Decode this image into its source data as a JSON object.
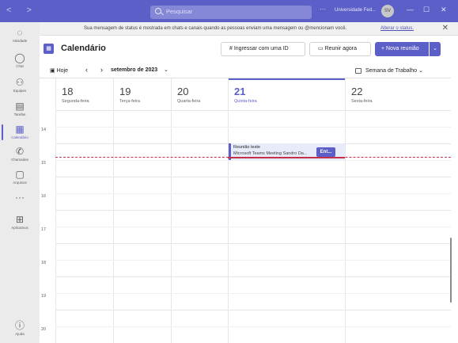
{
  "titlebar": {
    "search_placeholder": "Pesquisar",
    "org": "Universidade Fed...",
    "avatar_initials": "SV"
  },
  "rail": [
    {
      "label": "Atividade",
      "icon": "bell-icon"
    },
    {
      "label": "Chat",
      "icon": "chat-icon"
    },
    {
      "label": "Equipes",
      "icon": "teams-icon"
    },
    {
      "label": "Tarefas",
      "icon": "tasks-icon"
    },
    {
      "label": "Calendário",
      "icon": "calendar-icon"
    },
    {
      "label": "Chamadas",
      "icon": "phone-icon"
    },
    {
      "label": "Arquivos",
      "icon": "files-icon"
    },
    {
      "label": "Aplicativos",
      "icon": "apps-icon"
    },
    {
      "label": "Ajuda",
      "icon": "help-icon"
    }
  ],
  "notice": {
    "text": "Sua mensagem de status é mostrada em chats e canais quando as pessoas enviam uma mensagem ou @mencionam você.",
    "link": "Alterar o status."
  },
  "header": {
    "title": "Calendário",
    "join_id": "Ingressar com uma ID",
    "meet_now": "Reunir agora",
    "new_meeting": "Nova reunião"
  },
  "nav": {
    "today": "Hoje",
    "month": "setembro de 2023",
    "view": "Semana de Trabalho"
  },
  "days": [
    {
      "num": "18",
      "name": "Segunda-feira"
    },
    {
      "num": "19",
      "name": "Terça-feira"
    },
    {
      "num": "20",
      "name": "Quarta-feira"
    },
    {
      "num": "21",
      "name": "Quinta-feira"
    },
    {
      "num": "22",
      "name": "Sexta-feira"
    }
  ],
  "hours": [
    "14",
    "15",
    "16",
    "17",
    "18",
    "19",
    "20"
  ],
  "event": {
    "title": "Reunião teste",
    "subtitle": "Microsoft Teams Meeting  Sandro Da...",
    "join": "Ent..."
  },
  "colors": {
    "accent": "#5b5fc7",
    "now_line": "#c4314b",
    "event_bg": "#e8ebfa"
  }
}
